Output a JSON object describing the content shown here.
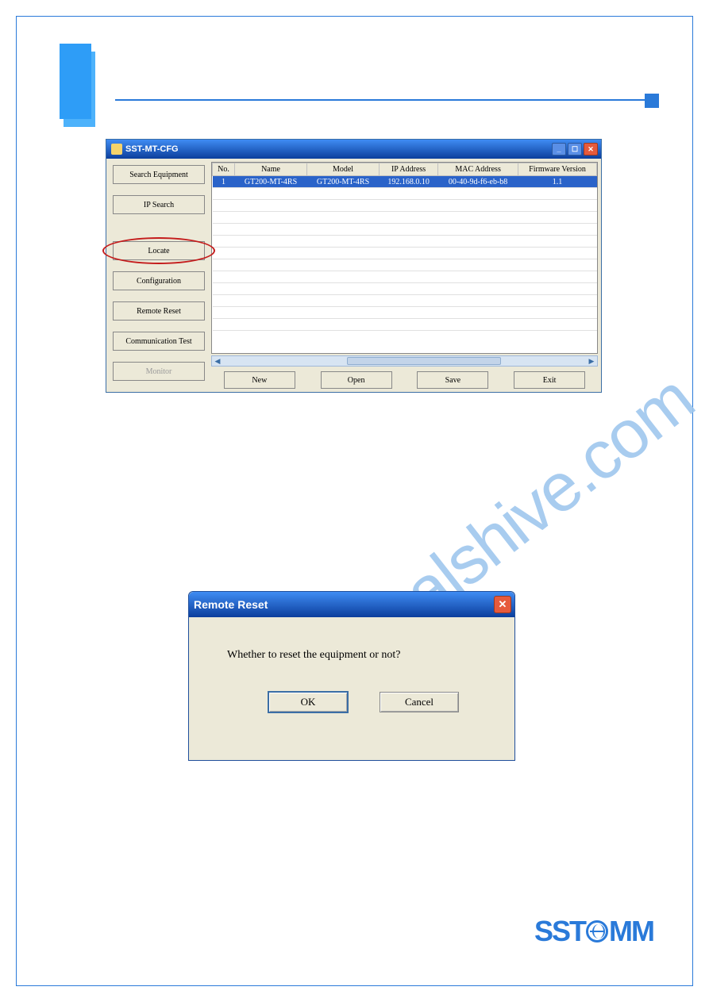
{
  "watermark": "manualshive.com",
  "logo_text_pre": "SST",
  "logo_text_post": "MM",
  "main_window": {
    "title": "SST-MT-CFG",
    "sidebar": {
      "search_equipment": "Search Equipment",
      "ip_search": "IP Search",
      "locate": "Locate",
      "configuration": "Configuration",
      "remote_reset": "Remote Reset",
      "communication_test": "Communication Test",
      "monitor": "Monitor"
    },
    "grid": {
      "headers": {
        "no": "No.",
        "name": "Name",
        "model": "Model",
        "ip": "IP Address",
        "mac": "MAC Address",
        "fw": "Firmware Version"
      },
      "row": {
        "no": "1",
        "name": "GT200-MT-4RS",
        "model": "GT200-MT-4RS",
        "ip": "192.168.0.10",
        "mac": "00-40-9d-f6-eb-b8",
        "fw": "1.1"
      }
    },
    "bottom": {
      "new": "New",
      "open": "Open",
      "save": "Save",
      "exit": "Exit"
    }
  },
  "dialog": {
    "title": "Remote Reset",
    "message": "Whether to reset the equipment or not?",
    "ok": "OK",
    "cancel": "Cancel"
  }
}
